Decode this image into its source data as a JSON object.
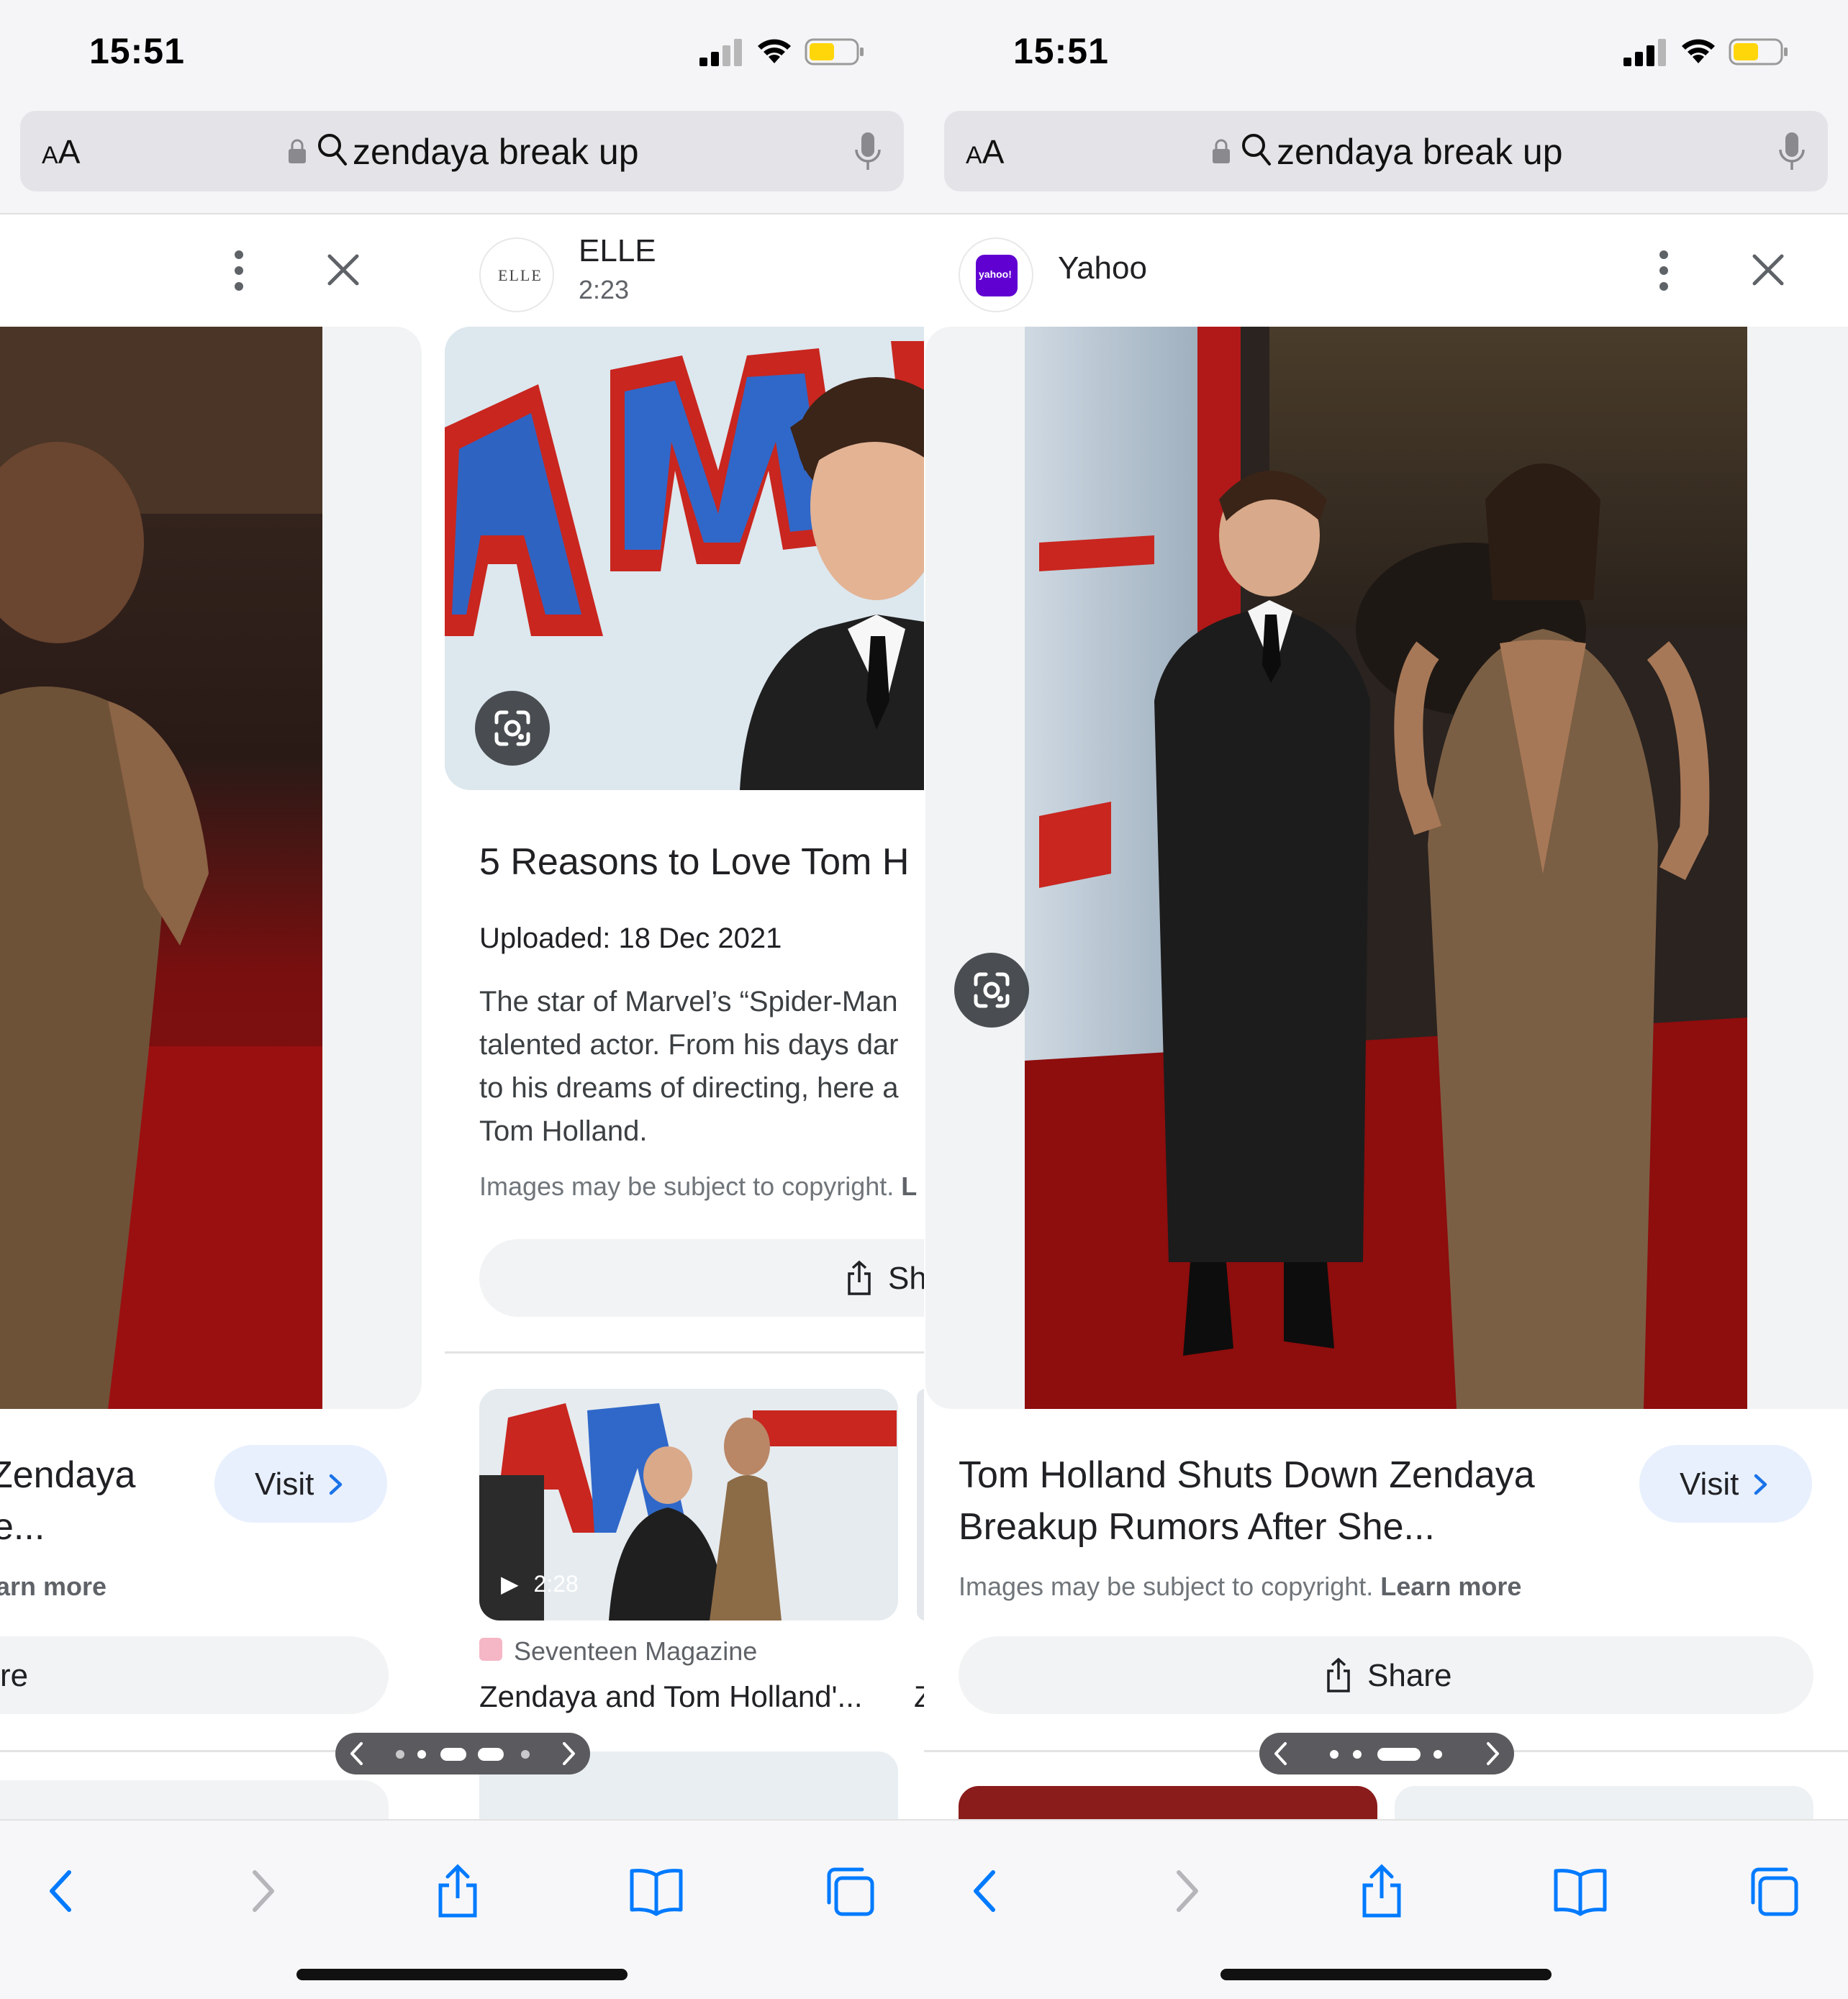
{
  "status_bar": {
    "time": "15:51"
  },
  "address_bar": {
    "aa_label": "AA",
    "query": "zendaya break up"
  },
  "left_phone": {
    "prev_card": {
      "title_line1": "Zendaya",
      "title_line2": "e...",
      "learn_more_fragment": "arn more",
      "share_fragment": "re",
      "visit_label": "Visit"
    },
    "current_card": {
      "source_name": "ELLE",
      "source_logo_text": "ELLE",
      "duration": "2:23",
      "title": "5 Reasons to Love Tom H",
      "uploaded": "Uploaded: 18 Dec 2021",
      "description": [
        "The star of Marvel’s “Spider-Man",
        "talented actor. From his days dar",
        "to his dreams of directing, here a",
        "Tom Holland."
      ],
      "copyright": "Images may be subject to copyright.",
      "copyright_link": "L",
      "share_label": "Sh"
    },
    "related": {
      "duration": "2:28",
      "source": "Seventeen Magazine",
      "title": "Zendaya and Tom Holland'...",
      "next_initial": "Z"
    }
  },
  "right_phone": {
    "source_name": "Yahoo",
    "source_logo_text": "yahoo!",
    "title_line1": "Tom Holland Shuts Down Zendaya",
    "title_line2": "Breakup Rumors After She...",
    "visit_label": "Visit",
    "copyright": "Images may be subject to copyright.",
    "learn_more": "Learn more",
    "share_label": "Share"
  },
  "colors": {
    "visit_bg": "#e8f0fe",
    "share_bg": "#f1f3f4",
    "battery": "#ffd60a",
    "yahoo_purple": "#6001d2",
    "safari_blue": "#007aff"
  }
}
